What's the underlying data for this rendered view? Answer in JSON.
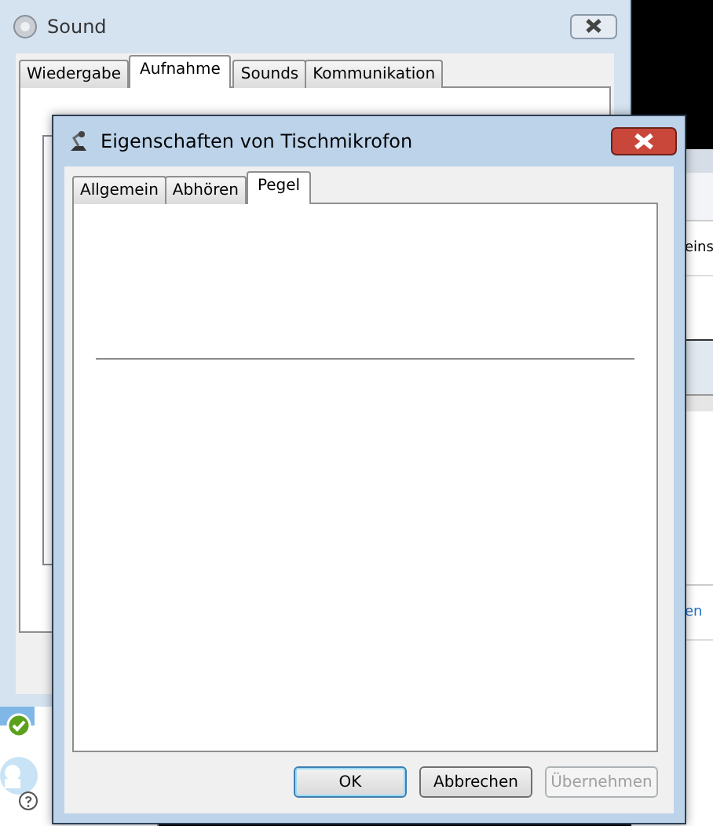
{
  "sound_window": {
    "title": "Sound",
    "tabs": [
      {
        "label": "Wiedergabe",
        "selected": false
      },
      {
        "label": "Aufnahme",
        "selected": true
      },
      {
        "label": "Sounds",
        "selected": false
      },
      {
        "label": "Kommunikation",
        "selected": false
      }
    ]
  },
  "properties_dialog": {
    "title": "Eigenschaften von Tischmikrofon",
    "tabs": [
      {
        "label": "Allgemein",
        "selected": false
      },
      {
        "label": "Abhören",
        "selected": false
      },
      {
        "label": "Pegel",
        "selected": true
      }
    ],
    "buttons": [
      {
        "label": "OK",
        "default": true,
        "disabled": false
      },
      {
        "label": "Abbrechen",
        "default": false,
        "disabled": false
      },
      {
        "label": "Übernehmen",
        "default": false,
        "disabled": true
      }
    ]
  },
  "background_window": {
    "fragments": [
      {
        "text": "eins",
        "kind": "label"
      },
      {
        "text": "en",
        "kind": "link"
      }
    ]
  }
}
